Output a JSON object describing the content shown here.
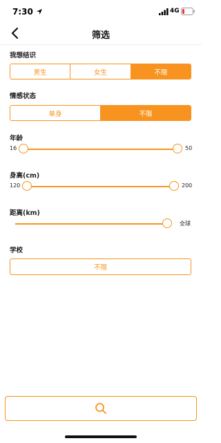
{
  "status_bar": {
    "time": "7:30",
    "network": "4G",
    "icons": [
      "location-arrow-icon",
      "signal-bars-icon",
      "battery-low-icon"
    ]
  },
  "nav": {
    "title": "筛选",
    "back_icon": "chevron-left-icon"
  },
  "accent_color": "#f7931e",
  "gender": {
    "label": "我想结识",
    "options": [
      "男生",
      "女生",
      "不限"
    ],
    "selected": "不限"
  },
  "relationship": {
    "label": "情感状态",
    "options": [
      "单身",
      "不限"
    ],
    "selected": "不限"
  },
  "age": {
    "label": "年龄",
    "min_label": "16",
    "max_label": "50",
    "range": [
      16,
      50
    ]
  },
  "height": {
    "label": "身高(cm)",
    "min_label": "120",
    "max_label": "200",
    "range": [
      120,
      200
    ]
  },
  "distance": {
    "label": "距离(km)",
    "max_label": "全球",
    "value_fraction": 1.0
  },
  "school": {
    "label": "学校",
    "button_label": "不限"
  },
  "search": {
    "icon": "search-icon"
  }
}
